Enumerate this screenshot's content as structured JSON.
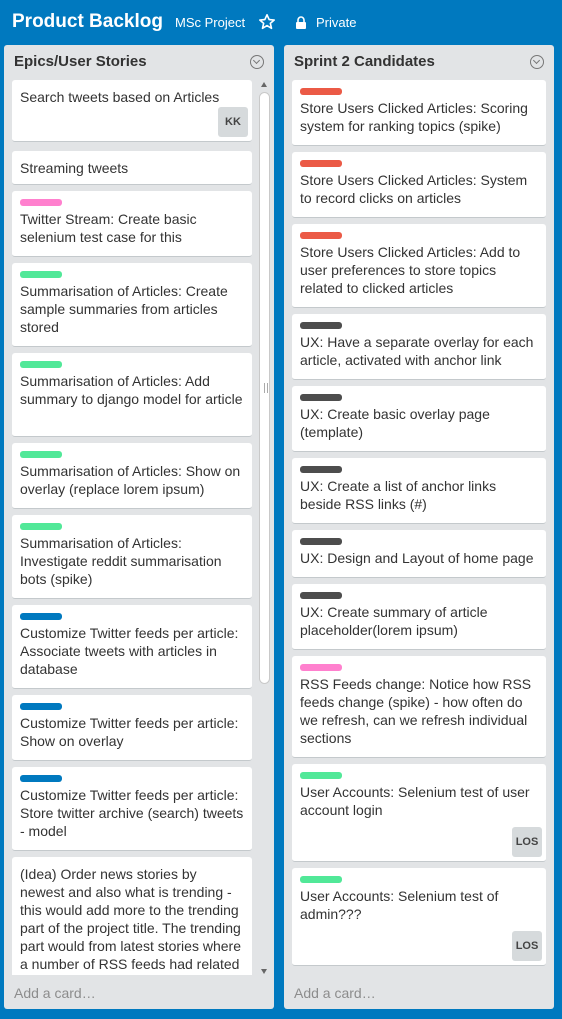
{
  "board": {
    "title": "Product Backlog",
    "org": "MSc Project",
    "visibility": "Private"
  },
  "colors": {
    "pink": "#ff80ce",
    "green": "#51e898",
    "blue": "#0079bf",
    "red": "#eb5a46",
    "black": "#4d4d4d"
  },
  "lists": [
    {
      "title": "Epics/User Stories",
      "add_card": "Add a card…",
      "cards": [
        {
          "title": "Search tweets based on Articles",
          "member": "KK"
        },
        {
          "title": "Streaming tweets"
        },
        {
          "label": "pink",
          "title": "Twitter Stream: Create basic selenium test case for this"
        },
        {
          "label": "green",
          "title": "Summarisation of Articles: Create sample summaries from articles stored"
        },
        {
          "label": "green",
          "title": "Summarisation of Articles: Add summary to django model for article"
        },
        {
          "label": "green",
          "title": "Summarisation of Articles: Show on overlay (replace lorem ipsum)"
        },
        {
          "label": "green",
          "title": "Summarisation of Articles: Investigate reddit summarisation bots (spike)"
        },
        {
          "label": "blue",
          "title": "Customize Twitter feeds per article: Associate tweets with articles in database"
        },
        {
          "label": "blue",
          "title": "Customize Twitter feeds per article: Show on overlay"
        },
        {
          "label": "blue",
          "title": "Customize Twitter feeds per article: Store twitter archive (search) tweets - model"
        },
        {
          "title": "(Idea) Order news stories by newest and also what is trending - this would add more to the trending part of the project title. The trending part would from latest stories where a number of RSS feeds had related stories"
        }
      ]
    },
    {
      "title": "Sprint 2 Candidates",
      "add_card": "Add a card…",
      "cards": [
        {
          "label": "red",
          "title": "Store Users Clicked Articles: Scoring system for ranking topics (spike)"
        },
        {
          "label": "red",
          "title": "Store Users Clicked Articles: System to record clicks on articles"
        },
        {
          "label": "red",
          "title": "Store Users Clicked Articles: Add to user preferences to store topics related to clicked articles"
        },
        {
          "label": "black",
          "title": "UX: Have a separate overlay for each article, activated with anchor link"
        },
        {
          "label": "black",
          "title": "UX: Create basic overlay page (template)"
        },
        {
          "label": "black",
          "title": "UX: Create a list of anchor links beside RSS links (#)"
        },
        {
          "label": "black",
          "title": "UX: Design and Layout of home page"
        },
        {
          "label": "black",
          "title": "UX: Create summary of article placeholder(lorem ipsum)"
        },
        {
          "label": "pink",
          "title": "RSS Feeds change: Notice how RSS feeds change (spike) - how often do we refresh, can we refresh individual sections"
        },
        {
          "label": "green",
          "title": "User Accounts: Selenium test of user account login",
          "member": "LOS"
        },
        {
          "label": "green",
          "title": "User Accounts: Selenium test of admin???",
          "member": "LOS"
        }
      ]
    }
  ]
}
